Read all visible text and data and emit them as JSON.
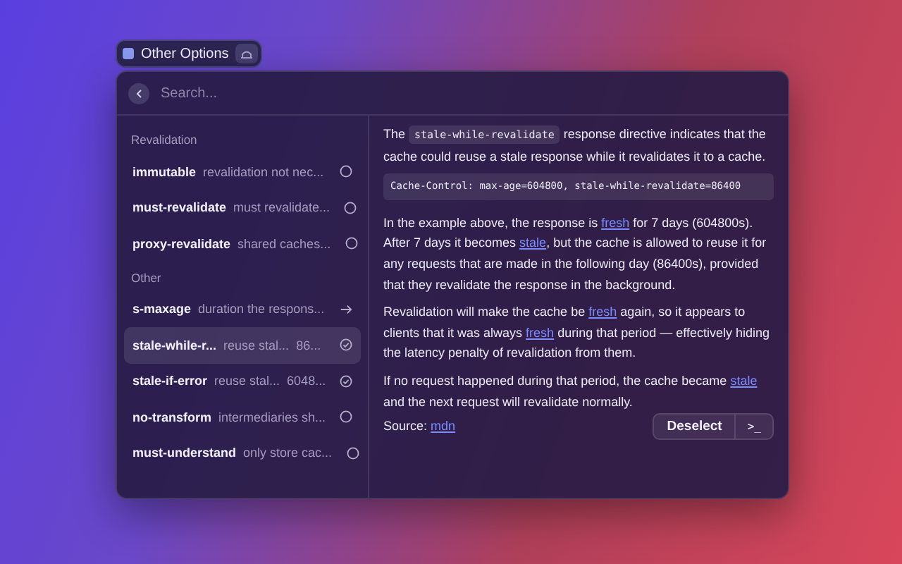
{
  "tag": {
    "label": "Other Options"
  },
  "search": {
    "placeholder": "Search..."
  },
  "sections": [
    {
      "title": "Revalidation",
      "items": [
        {
          "name": "immutable",
          "description": "revalidation not nec...",
          "kind": "circle",
          "selected": false
        },
        {
          "name": "must-revalidate",
          "description": "must revalidate...",
          "kind": "circle",
          "selected": false
        },
        {
          "name": "proxy-revalidate",
          "description": "shared caches...",
          "kind": "circle",
          "selected": false
        }
      ]
    },
    {
      "title": "Other",
      "items": [
        {
          "name": "s-maxage",
          "description": "duration the respons...",
          "kind": "arrow",
          "selected": false
        },
        {
          "name": "stale-while-r...",
          "description": "reuse stal...",
          "value": "86...",
          "kind": "check",
          "selected": true
        },
        {
          "name": "stale-if-error",
          "description": "reuse stal...",
          "value": "6048...",
          "kind": "check",
          "selected": false
        },
        {
          "name": "no-transform",
          "description": "intermediaries sh...",
          "kind": "circle",
          "selected": false
        },
        {
          "name": "must-understand",
          "description": "only store cac...",
          "kind": "circle",
          "selected": false
        }
      ]
    }
  ],
  "detail": {
    "paragraphs": [
      [
        {
          "kind": "text",
          "text": "The "
        },
        {
          "kind": "code",
          "text": "stale-while-revalidate"
        },
        {
          "kind": "text",
          "text": " response directive indicates that the cache could reuse a stale response while it revalidates it to a cache."
        }
      ],
      [
        {
          "kind": "block",
          "text": "Cache-Control: max-age=604800, stale-while-revalidate=86400"
        }
      ],
      [
        {
          "kind": "text",
          "text": "In the example above, the response is "
        },
        {
          "kind": "link",
          "text": "fresh"
        },
        {
          "kind": "text",
          "text": " for 7 days (604800s). After 7 days it becomes "
        },
        {
          "kind": "link",
          "text": "stale"
        },
        {
          "kind": "text",
          "text": ", but the cache is allowed to reuse it for any requests that are made in the following day (86400s), provided that they revalidate the response in the background."
        }
      ],
      [
        {
          "kind": "text",
          "text": "Revalidation will make the cache be "
        },
        {
          "kind": "link",
          "text": "fresh"
        },
        {
          "kind": "text",
          "text": " again, so it appears to clients that it was always "
        },
        {
          "kind": "link",
          "text": "fresh"
        },
        {
          "kind": "text",
          "text": " during that period — effectively hiding the latency penalty of revalidation from them."
        }
      ],
      [
        {
          "kind": "text",
          "text": "If no request happened during that period, the cache became "
        },
        {
          "kind": "link",
          "text": "stale"
        },
        {
          "kind": "text",
          "text": " and the next request will revalidate normally."
        }
      ]
    ],
    "source": {
      "label": "Source:",
      "link": "mdn"
    }
  },
  "actions": {
    "primary": "Deselect",
    "secondary": ">_"
  }
}
